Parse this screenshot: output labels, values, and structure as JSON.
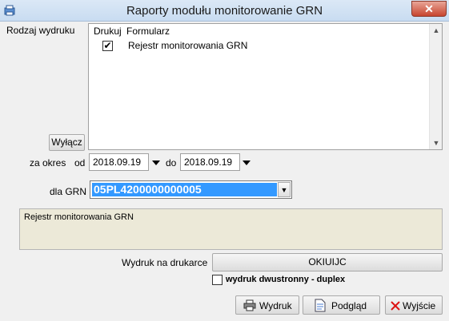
{
  "window": {
    "title": "Raporty modułu  monitorowanie GRN",
    "close_symbol": "✕"
  },
  "form": {
    "rodzaj_label": "Rodzaj wydruku",
    "wylacz_label": "Wyłącz",
    "list_headers": [
      "Drukuj",
      "Formularz"
    ],
    "list_items": [
      {
        "checked": true,
        "check_mark": "✔",
        "label": "Rejestr monitorowania GRN"
      }
    ],
    "za_okres_label": "za okres",
    "od_label": "od",
    "date_from": "2018.09.19",
    "do_label": "do",
    "date_to": "2018.09.19",
    "dla_grn_label": "dla GRN",
    "grn_value": "05PL4200000000005",
    "description": "Rejestr monitorowania GRN",
    "printer_label": "Wydruk na drukarce",
    "printer_value": "OKIUIJC",
    "duplex_label": "wydruk dwustronny - duplex",
    "duplex_checked": false
  },
  "buttons": {
    "print": "Wydruk",
    "preview": "Podgląd",
    "exit": "Wyjście"
  }
}
